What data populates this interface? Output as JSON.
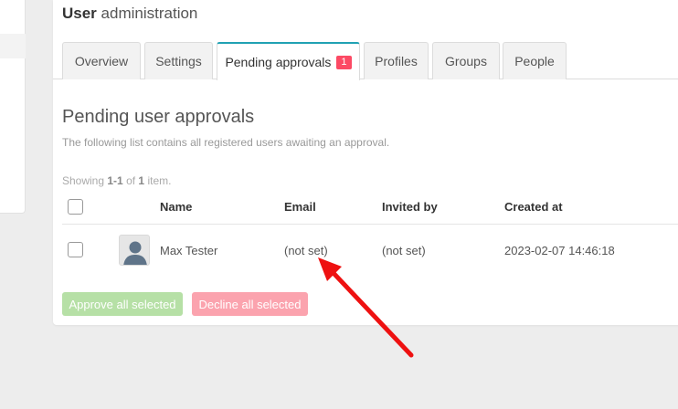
{
  "header": {
    "title_bold": "User",
    "title_rest": "administration"
  },
  "tabs": [
    {
      "label": "Overview"
    },
    {
      "label": "Settings"
    },
    {
      "label": "Pending approvals",
      "badge": "1",
      "active": true
    },
    {
      "label": "Profiles"
    },
    {
      "label": "Groups"
    },
    {
      "label": "People"
    }
  ],
  "section": {
    "title": "Pending user approvals",
    "description": "The following list contains all registered users awaiting an approval."
  },
  "summary": {
    "prefix": "Showing",
    "range": "1-1",
    "of": "of",
    "total": "1",
    "suffix": "item."
  },
  "table": {
    "columns": [
      "Name",
      "Email",
      "Invited by",
      "Created at"
    ],
    "rows": [
      {
        "name": "Max Tester",
        "email": "(not set)",
        "invited_by": "(not set)",
        "created_at": "2023-02-07 14:46:18"
      }
    ]
  },
  "actions": {
    "approve_label": "Approve all selected",
    "decline_label": "Decline all selected"
  },
  "colors": {
    "accent": "#21a1b3",
    "badge": "#fc4a64",
    "approve": "#b6e0a6",
    "decline": "#fba3ae",
    "arrow": "#ee1111"
  },
  "icons": {
    "avatar": "user-avatar-icon",
    "annotation": "red-arrow-annotation"
  }
}
